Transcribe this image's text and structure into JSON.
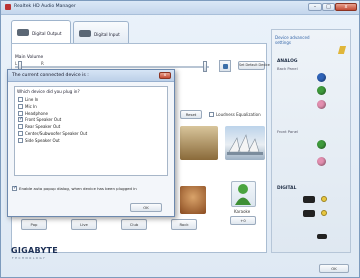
{
  "window": {
    "title": "Realtek HD Audio Manager",
    "min": "–",
    "max": "□",
    "close": "x"
  },
  "tabs": [
    {
      "label": "Digital Output"
    },
    {
      "label": "Digital Input"
    }
  ],
  "main_volume": {
    "label": "Main Volume",
    "left": "L",
    "right": "R",
    "balance_fraction": 0.15,
    "volume_fraction": 0.98
  },
  "set_default_button": "Set Default Device",
  "reset_button": "Reset",
  "loudness_label": "Loudness Equalization",
  "bottom_buttons": [
    "Pop",
    "Live",
    "Club",
    "Rock"
  ],
  "karaoke_label": "Karaoke",
  "karaoke_value": "+0",
  "sidebar": {
    "link_lines": [
      "Device advanced",
      "settings"
    ],
    "analog_title": "ANALOG",
    "back_panel": "Back Panel",
    "front_panel": "Front Panel",
    "digital_title": "DIGITAL"
  },
  "footer": {
    "brand": "GIGABYTE",
    "brand_sub": "TECHNOLOGY",
    "ok": "OK"
  },
  "dialog": {
    "title": "The current connected device is :",
    "close": "x",
    "question": "Which device did you plug in?",
    "options": [
      {
        "label": "Line In",
        "checked": false
      },
      {
        "label": "Mic In",
        "checked": false
      },
      {
        "label": "Headphone",
        "checked": false
      },
      {
        "label": "Front Speaker Out",
        "checked": true
      },
      {
        "label": "Rear Speaker Out",
        "checked": false
      },
      {
        "label": "Center/Subwoofer Speaker Out",
        "checked": false
      },
      {
        "label": "Side Speaker Out",
        "checked": false
      }
    ],
    "auto_popup": {
      "label": "Enable auto popup dialog, when device has been plugged in",
      "checked": true
    },
    "ok": "OK"
  },
  "colors": {
    "jack_green": "#3f9b3c",
    "jack_blue": "#2f63b8",
    "jack_pink": "#e38fb0",
    "accent": "#3264a8"
  }
}
